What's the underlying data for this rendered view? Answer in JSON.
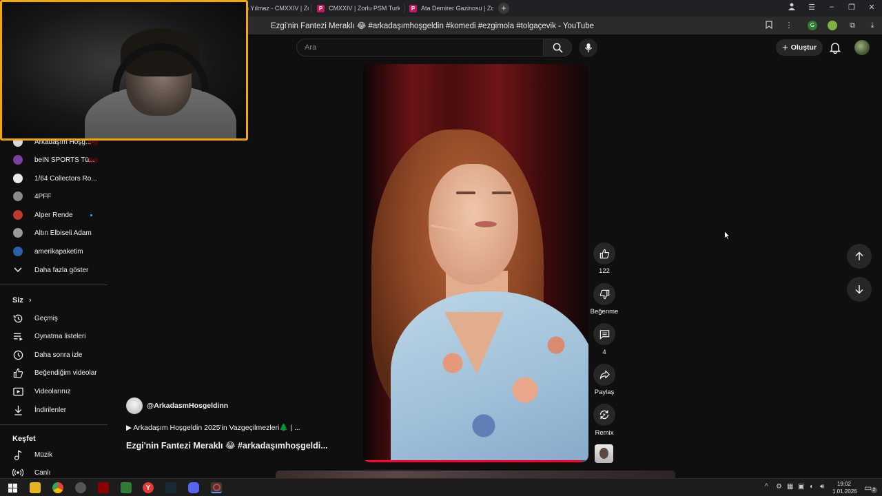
{
  "browser": {
    "tabs": [
      {
        "label": "n Yılmaz - CMXXIV | Zo"
      },
      {
        "label": "CMXXIV | Zorlu PSM Turkc",
        "favicon": "P"
      },
      {
        "label": "Ata Demirer Gazinosu | Zo",
        "favicon": "P"
      }
    ],
    "new_tab_label": "+",
    "page_title": "Ezgi'nin Fantezi Meraklı 😂 #arkadaşımhoşgeldin #komedi #ezgimola #tolgaçevik - YouTube"
  },
  "header": {
    "search_placeholder": "Ara",
    "create_label": "Oluştur"
  },
  "sidebar": {
    "subscriptions": [
      {
        "label": "Arkadaşım Hoşg...",
        "status": "live",
        "color": "#d8d8d8"
      },
      {
        "label": "beIN SPORTS Tü...",
        "status": "live",
        "color": "#7b3fa0"
      },
      {
        "label": "1/64 Collectors Ro...",
        "status": "",
        "color": "#e8e8e8"
      },
      {
        "label": "4PFF",
        "status": "",
        "color": "#8a8a8a"
      },
      {
        "label": "Alper Rende",
        "status": "new",
        "color": "#c0392b"
      },
      {
        "label": "Altın Elbiseli Adam",
        "status": "",
        "color": "#9a9a9a"
      },
      {
        "label": "amerikapaketim",
        "status": "",
        "color": "#2b5fa8"
      }
    ],
    "show_more_label": "Daha fazla göster",
    "you_section": {
      "heading": "Siz",
      "items": [
        {
          "label": "Geçmiş",
          "icon": "history-icon"
        },
        {
          "label": "Oynatma listeleri",
          "icon": "playlists-icon"
        },
        {
          "label": "Daha sonra izle",
          "icon": "watch-later-icon"
        },
        {
          "label": "Beğendiğim videolar",
          "icon": "liked-videos-icon"
        },
        {
          "label": "Videolarınız",
          "icon": "your-videos-icon"
        },
        {
          "label": "İndirilenler",
          "icon": "downloads-icon"
        }
      ]
    },
    "explore_section": {
      "heading": "Keşfet",
      "items": [
        {
          "label": "Müzik",
          "icon": "music-icon"
        },
        {
          "label": "Canlı",
          "icon": "live-icon"
        }
      ]
    }
  },
  "short": {
    "channel_handle": "@ArkadasmHosgeldinn",
    "playlist_label": "▶ Arkadaşım Hoşgeldin 2025'in Vazgeçilmezleri🌲 | ...",
    "title": "Ezgi'nin Fantezi Meraklı 😂 #arkadaşımhoşgeldi...",
    "progress": 0.97,
    "actions": {
      "like_count": "122",
      "dislike_label": "Beğenme",
      "comment_count": "4",
      "share_label": "Paylaş",
      "remix_label": "Remix"
    }
  },
  "taskbar": {
    "time": "19:02",
    "date": "1.01.2026",
    "notification_count": "2"
  }
}
